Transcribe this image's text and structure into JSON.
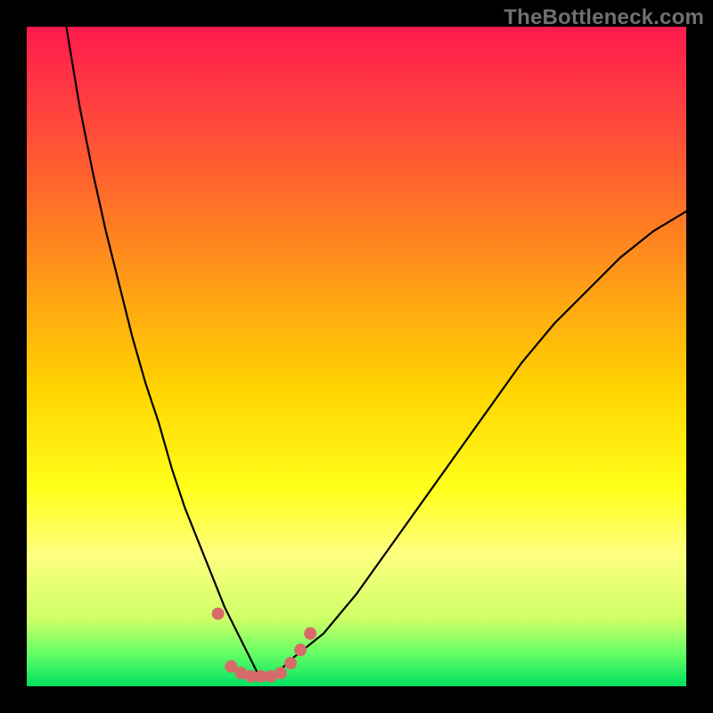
{
  "watermark": "TheBottleneck.com",
  "colors": {
    "background": "#000000",
    "gradient_top": "#ff1a4d",
    "gradient_bottom": "#00e060",
    "curve": "#000000",
    "marker": "#d86a6a"
  },
  "chart_data": {
    "type": "line",
    "title": "",
    "xlabel": "",
    "ylabel": "",
    "xlim": [
      0,
      100
    ],
    "ylim": [
      0,
      100
    ],
    "grid": false,
    "legend": false,
    "series": [
      {
        "name": "bottleneck-curve",
        "x": [
          6,
          8,
          10,
          12,
          14,
          16,
          18,
          20,
          22,
          24,
          26,
          28,
          30,
          32,
          34,
          35,
          36,
          38,
          40,
          45,
          50,
          55,
          60,
          65,
          70,
          75,
          80,
          85,
          90,
          95,
          100
        ],
        "y": [
          100,
          88,
          78,
          69,
          61,
          53,
          46,
          40,
          33,
          27,
          22,
          17,
          12,
          8,
          4,
          2,
          2,
          2,
          4,
          8,
          14,
          21,
          28,
          35,
          42,
          49,
          55,
          60,
          65,
          69,
          72
        ]
      }
    ],
    "markers": {
      "name": "annotation-dots",
      "color": "#d86a6a",
      "points": [
        {
          "x": 29,
          "y": 11
        },
        {
          "x": 31,
          "y": 3
        },
        {
          "x": 32.5,
          "y": 2
        },
        {
          "x": 34,
          "y": 1.5
        },
        {
          "x": 35.5,
          "y": 1.5
        },
        {
          "x": 37,
          "y": 1.5
        },
        {
          "x": 38.5,
          "y": 2
        },
        {
          "x": 40,
          "y": 3.5
        },
        {
          "x": 41.5,
          "y": 5.5
        },
        {
          "x": 43,
          "y": 8
        }
      ]
    }
  }
}
